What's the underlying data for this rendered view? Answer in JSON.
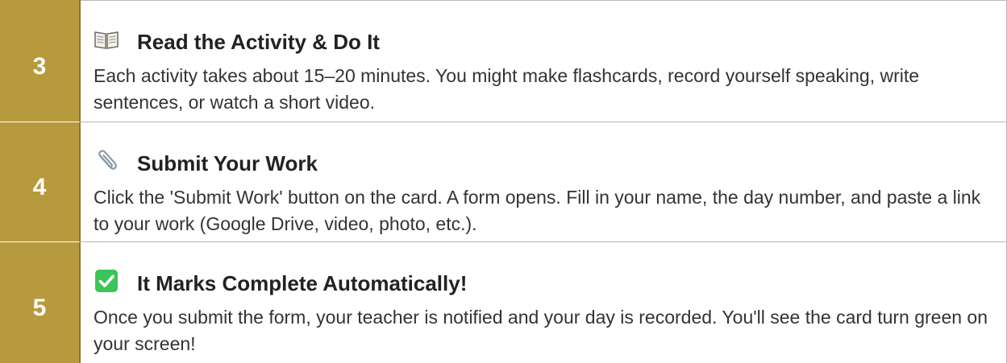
{
  "steps": [
    {
      "number": "3",
      "icon": "open-book-icon",
      "title": "Read the Activity & Do It",
      "description": "Each activity takes about 15–20 minutes. You might make flashcards, record yourself speaking, write sentences, or watch a short video."
    },
    {
      "number": "4",
      "icon": "paperclip-icon",
      "title": "Submit Your Work",
      "description": "Click the 'Submit Work' button on the card. A form opens. Fill in your name, the day number, and paste a link to your work (Google Drive, video, photo, etc.)."
    },
    {
      "number": "5",
      "icon": "green-check-icon",
      "title": "It Marks Complete Automatically!",
      "description": "Once you submit the form, your teacher is notified and your day is recorded. You'll see the card turn green on your screen!"
    }
  ],
  "colors": {
    "number_column": "#b89a3e",
    "check_green": "#3cc35a"
  }
}
